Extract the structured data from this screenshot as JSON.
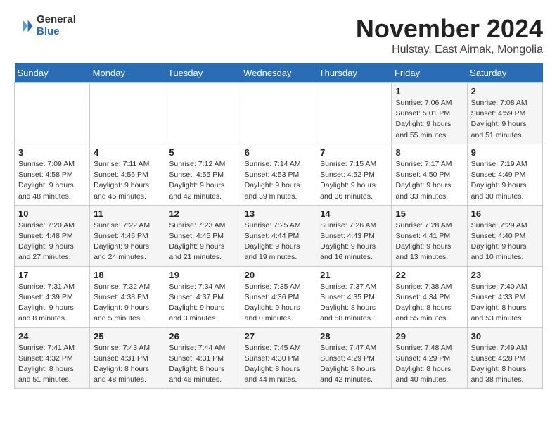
{
  "logo": {
    "general": "General",
    "blue": "Blue"
  },
  "title": "November 2024",
  "location": "Hulstay, East Aimak, Mongolia",
  "days_header": [
    "Sunday",
    "Monday",
    "Tuesday",
    "Wednesday",
    "Thursday",
    "Friday",
    "Saturday"
  ],
  "weeks": [
    [
      {
        "day": "",
        "info": ""
      },
      {
        "day": "",
        "info": ""
      },
      {
        "day": "",
        "info": ""
      },
      {
        "day": "",
        "info": ""
      },
      {
        "day": "",
        "info": ""
      },
      {
        "day": "1",
        "info": "Sunrise: 7:06 AM\nSunset: 5:01 PM\nDaylight: 9 hours\nand 55 minutes."
      },
      {
        "day": "2",
        "info": "Sunrise: 7:08 AM\nSunset: 4:59 PM\nDaylight: 9 hours\nand 51 minutes."
      }
    ],
    [
      {
        "day": "3",
        "info": "Sunrise: 7:09 AM\nSunset: 4:58 PM\nDaylight: 9 hours\nand 48 minutes."
      },
      {
        "day": "4",
        "info": "Sunrise: 7:11 AM\nSunset: 4:56 PM\nDaylight: 9 hours\nand 45 minutes."
      },
      {
        "day": "5",
        "info": "Sunrise: 7:12 AM\nSunset: 4:55 PM\nDaylight: 9 hours\nand 42 minutes."
      },
      {
        "day": "6",
        "info": "Sunrise: 7:14 AM\nSunset: 4:53 PM\nDaylight: 9 hours\nand 39 minutes."
      },
      {
        "day": "7",
        "info": "Sunrise: 7:15 AM\nSunset: 4:52 PM\nDaylight: 9 hours\nand 36 minutes."
      },
      {
        "day": "8",
        "info": "Sunrise: 7:17 AM\nSunset: 4:50 PM\nDaylight: 9 hours\nand 33 minutes."
      },
      {
        "day": "9",
        "info": "Sunrise: 7:19 AM\nSunset: 4:49 PM\nDaylight: 9 hours\nand 30 minutes."
      }
    ],
    [
      {
        "day": "10",
        "info": "Sunrise: 7:20 AM\nSunset: 4:48 PM\nDaylight: 9 hours\nand 27 minutes."
      },
      {
        "day": "11",
        "info": "Sunrise: 7:22 AM\nSunset: 4:46 PM\nDaylight: 9 hours\nand 24 minutes."
      },
      {
        "day": "12",
        "info": "Sunrise: 7:23 AM\nSunset: 4:45 PM\nDaylight: 9 hours\nand 21 minutes."
      },
      {
        "day": "13",
        "info": "Sunrise: 7:25 AM\nSunset: 4:44 PM\nDaylight: 9 hours\nand 19 minutes."
      },
      {
        "day": "14",
        "info": "Sunrise: 7:26 AM\nSunset: 4:43 PM\nDaylight: 9 hours\nand 16 minutes."
      },
      {
        "day": "15",
        "info": "Sunrise: 7:28 AM\nSunset: 4:41 PM\nDaylight: 9 hours\nand 13 minutes."
      },
      {
        "day": "16",
        "info": "Sunrise: 7:29 AM\nSunset: 4:40 PM\nDaylight: 9 hours\nand 10 minutes."
      }
    ],
    [
      {
        "day": "17",
        "info": "Sunrise: 7:31 AM\nSunset: 4:39 PM\nDaylight: 9 hours\nand 8 minutes."
      },
      {
        "day": "18",
        "info": "Sunrise: 7:32 AM\nSunset: 4:38 PM\nDaylight: 9 hours\nand 5 minutes."
      },
      {
        "day": "19",
        "info": "Sunrise: 7:34 AM\nSunset: 4:37 PM\nDaylight: 9 hours\nand 3 minutes."
      },
      {
        "day": "20",
        "info": "Sunrise: 7:35 AM\nSunset: 4:36 PM\nDaylight: 9 hours\nand 0 minutes."
      },
      {
        "day": "21",
        "info": "Sunrise: 7:37 AM\nSunset: 4:35 PM\nDaylight: 8 hours\nand 58 minutes."
      },
      {
        "day": "22",
        "info": "Sunrise: 7:38 AM\nSunset: 4:34 PM\nDaylight: 8 hours\nand 55 minutes."
      },
      {
        "day": "23",
        "info": "Sunrise: 7:40 AM\nSunset: 4:33 PM\nDaylight: 8 hours\nand 53 minutes."
      }
    ],
    [
      {
        "day": "24",
        "info": "Sunrise: 7:41 AM\nSunset: 4:32 PM\nDaylight: 8 hours\nand 51 minutes."
      },
      {
        "day": "25",
        "info": "Sunrise: 7:43 AM\nSunset: 4:31 PM\nDaylight: 8 hours\nand 48 minutes."
      },
      {
        "day": "26",
        "info": "Sunrise: 7:44 AM\nSunset: 4:31 PM\nDaylight: 8 hours\nand 46 minutes."
      },
      {
        "day": "27",
        "info": "Sunrise: 7:45 AM\nSunset: 4:30 PM\nDaylight: 8 hours\nand 44 minutes."
      },
      {
        "day": "28",
        "info": "Sunrise: 7:47 AM\nSunset: 4:29 PM\nDaylight: 8 hours\nand 42 minutes."
      },
      {
        "day": "29",
        "info": "Sunrise: 7:48 AM\nSunset: 4:29 PM\nDaylight: 8 hours\nand 40 minutes."
      },
      {
        "day": "30",
        "info": "Sunrise: 7:49 AM\nSunset: 4:28 PM\nDaylight: 8 hours\nand 38 minutes."
      }
    ]
  ]
}
